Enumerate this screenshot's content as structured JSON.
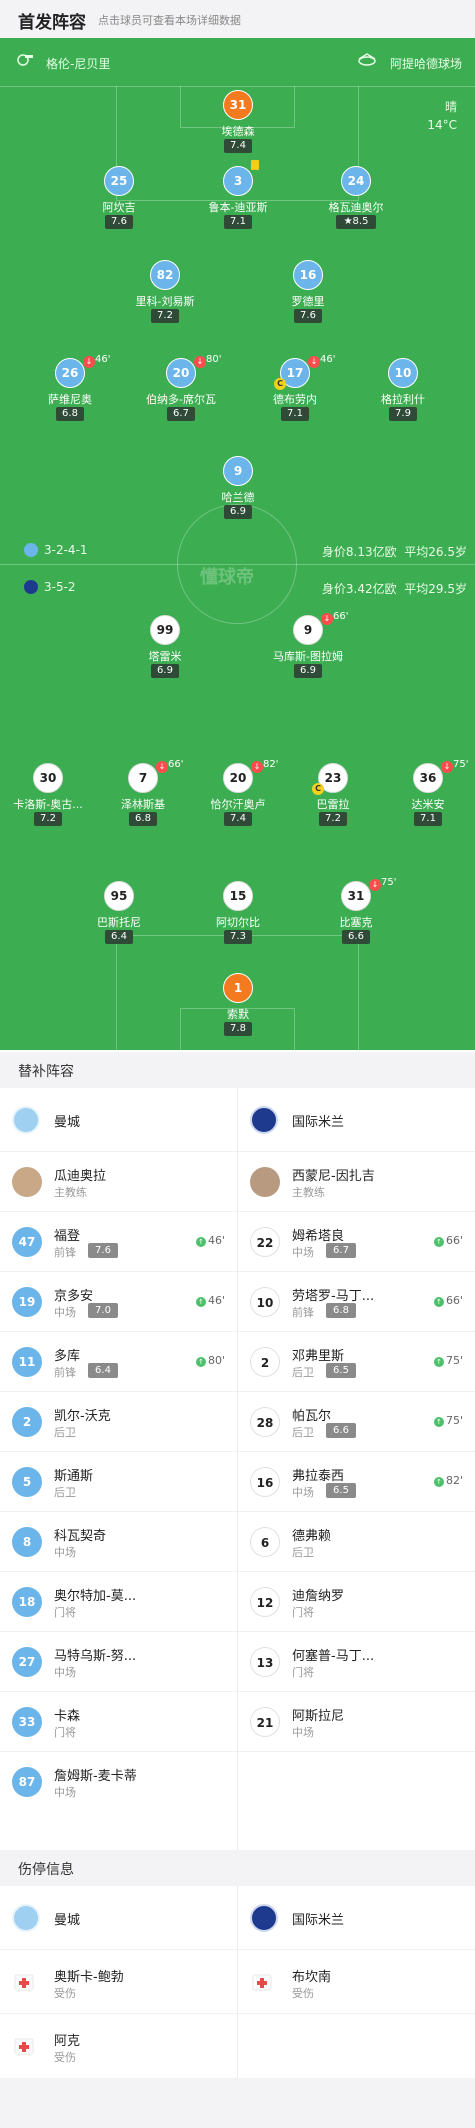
{
  "header": {
    "title": "首发阵容",
    "hint": "点击球员可查看本场详细数据"
  },
  "pitch": {
    "home_team": "格伦-尼贝里",
    "away_team": "阿提哈德球场",
    "weather": "晴",
    "temp": "14°C",
    "home_formation": "3-2-4-1",
    "home_value": "身价8.13亿欧",
    "home_age": "平均26.5岁",
    "away_formation": "3-5-2",
    "away_value": "身价3.42亿欧",
    "away_age": "平均29.5岁",
    "watermark": "懂球帝",
    "home_players": [
      {
        "num": "31",
        "name": "埃德森",
        "rating": "7.4"
      },
      {
        "num": "25",
        "name": "阿坎吉",
        "rating": "7.6"
      },
      {
        "num": "3",
        "name": "鲁本-迪亚斯",
        "rating": "7.1"
      },
      {
        "num": "24",
        "name": "格瓦迪奥尔",
        "rating": "8.5"
      },
      {
        "num": "82",
        "name": "里科-刘易斯",
        "rating": "7.2"
      },
      {
        "num": "16",
        "name": "罗德里",
        "rating": "7.6"
      },
      {
        "num": "26",
        "name": "萨维尼奥",
        "rating": "6.8",
        "sub": "46'"
      },
      {
        "num": "20",
        "name": "伯纳多-席尔瓦",
        "rating": "6.7",
        "sub": "80'"
      },
      {
        "num": "17",
        "name": "德布劳内",
        "rating": "7.1",
        "sub": "46'",
        "cap": "C"
      },
      {
        "num": "10",
        "name": "格拉利什",
        "rating": "7.9"
      },
      {
        "num": "9",
        "name": "哈兰德",
        "rating": "6.9"
      }
    ],
    "away_players": [
      {
        "num": "99",
        "name": "塔雷米",
        "rating": "6.9"
      },
      {
        "num": "9",
        "name": "马库斯-图拉姆",
        "rating": "6.9",
        "sub": "66'"
      },
      {
        "num": "30",
        "name": "卡洛斯-奥古...",
        "rating": "7.2"
      },
      {
        "num": "7",
        "name": "泽林斯基",
        "rating": "6.8",
        "sub": "66'"
      },
      {
        "num": "20",
        "name": "恰尔汗奥卢",
        "rating": "7.4",
        "sub": "82'"
      },
      {
        "num": "23",
        "name": "巴雷拉",
        "rating": "7.2",
        "cap": "C"
      },
      {
        "num": "36",
        "name": "达米安",
        "rating": "7.1",
        "sub": "75'"
      },
      {
        "num": "95",
        "name": "巴斯托尼",
        "rating": "6.4"
      },
      {
        "num": "15",
        "name": "阿切尔比",
        "rating": "7.3"
      },
      {
        "num": "31",
        "name": "比塞克",
        "rating": "6.6",
        "sub": "75'"
      },
      {
        "num": "1",
        "name": "索默",
        "rating": "7.8"
      }
    ]
  },
  "subs": {
    "title": "替补阵容",
    "home_name": "曼城",
    "away_name": "国际米兰",
    "home_coach": {
      "name": "瓜迪奥拉",
      "role": "主教练"
    },
    "away_coach": {
      "name": "西蒙尼-因扎吉",
      "role": "主教练"
    },
    "home": [
      {
        "num": "47",
        "name": "福登",
        "pos": "前锋",
        "rating": "7.6",
        "on": "46'"
      },
      {
        "num": "19",
        "name": "京多安",
        "pos": "中场",
        "rating": "7.0",
        "on": "46'"
      },
      {
        "num": "11",
        "name": "多库",
        "pos": "前锋",
        "rating": "6.4",
        "on": "80'"
      },
      {
        "num": "2",
        "name": "凯尔-沃克",
        "pos": "后卫"
      },
      {
        "num": "5",
        "name": "斯通斯",
        "pos": "后卫"
      },
      {
        "num": "8",
        "name": "科瓦契奇",
        "pos": "中场"
      },
      {
        "num": "18",
        "name": "奥尔特加-莫...",
        "pos": "门将"
      },
      {
        "num": "27",
        "name": "马特乌斯-努...",
        "pos": "中场"
      },
      {
        "num": "33",
        "name": "卡森",
        "pos": "门将"
      },
      {
        "num": "87",
        "name": "詹姆斯-麦卡蒂",
        "pos": "中场"
      }
    ],
    "away": [
      {
        "num": "22",
        "name": "姆希塔良",
        "pos": "中场",
        "rating": "6.7",
        "on": "66'"
      },
      {
        "num": "10",
        "name": "劳塔罗-马丁...",
        "pos": "前锋",
        "rating": "6.8",
        "on": "66'"
      },
      {
        "num": "2",
        "name": "邓弗里斯",
        "pos": "后卫",
        "rating": "6.5",
        "on": "75'"
      },
      {
        "num": "28",
        "name": "帕瓦尔",
        "pos": "后卫",
        "rating": "6.6",
        "on": "75'"
      },
      {
        "num": "16",
        "name": "弗拉泰西",
        "pos": "中场",
        "rating": "6.5",
        "on": "82'"
      },
      {
        "num": "6",
        "name": "德弗赖",
        "pos": "后卫"
      },
      {
        "num": "12",
        "name": "迪詹纳罗",
        "pos": "门将"
      },
      {
        "num": "13",
        "name": "何塞普-马丁...",
        "pos": "门将"
      },
      {
        "num": "21",
        "name": "阿斯拉尼",
        "pos": "中场"
      }
    ]
  },
  "injuries": {
    "title": "伤停信息",
    "home_name": "曼城",
    "away_name": "国际米兰",
    "home": [
      {
        "name": "奥斯卡-鲍勃",
        "status": "受伤"
      },
      {
        "name": "阿克",
        "status": "受伤"
      }
    ],
    "away": [
      {
        "name": "布坎南",
        "status": "受伤"
      }
    ]
  },
  "colors": {
    "pitch": "#3cae51",
    "home": "#6bb5ea",
    "home_gk": "#f47a1f",
    "rating_bg": "#2f4b38"
  }
}
